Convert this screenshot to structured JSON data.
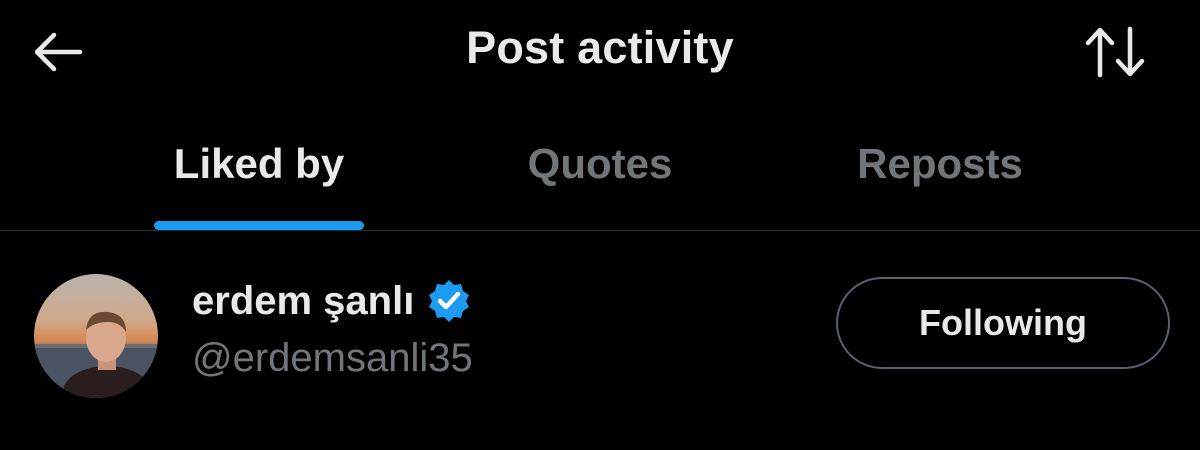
{
  "header": {
    "title": "Post activity",
    "back_icon": "arrow-left-icon",
    "sort_icon": "sort-arrows-icon"
  },
  "tabs": [
    {
      "label": "Liked by",
      "active": true
    },
    {
      "label": "Quotes",
      "active": false
    },
    {
      "label": "Reposts",
      "active": false
    }
  ],
  "user": {
    "display_name": "erdem şanlı",
    "handle": "@erdemsanli35",
    "verified": true,
    "follow_label": "Following"
  },
  "colors": {
    "background": "#000000",
    "text_primary": "#e7e9ea",
    "text_secondary": "#71767b",
    "accent": "#1d9bf0",
    "divider": "#2f3336"
  }
}
